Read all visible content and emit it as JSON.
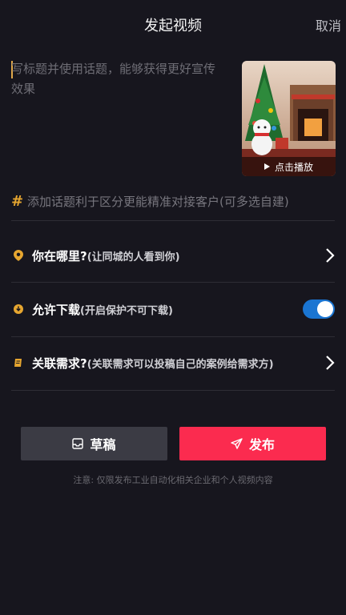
{
  "header": {
    "title": "发起视频",
    "cancel_label": "取消"
  },
  "description": {
    "placeholder": "写标题并使用话题，能够获得更好宣传效果"
  },
  "video": {
    "play_label": "点击播放"
  },
  "topic": {
    "icon": "hash-icon",
    "placeholder": "添加话题利于区分更能精准对接客户(可多选自建)"
  },
  "options": {
    "location": {
      "title": "你在哪里?",
      "subtitle": "(让同城的人看到你)",
      "icon": "location-pin-icon"
    },
    "download": {
      "title": "允许下载",
      "subtitle": "(开启保护不可下载)",
      "icon": "download-icon",
      "enabled": true
    },
    "demand": {
      "title": "关联需求?",
      "subtitle": "(关联需求可以投稿自己的案例给需求方)",
      "icon": "document-icon"
    }
  },
  "actions": {
    "draft_label": "草稿",
    "publish_label": "发布"
  },
  "note": "注意: 仅限发布工业自动化相关企业和个人视频内容",
  "colors": {
    "background": "#17161e",
    "accent_gold": "#e6a630",
    "toggle_on": "#1a75d2",
    "publish": "#fb2b4f",
    "draft": "#3b3b44"
  }
}
